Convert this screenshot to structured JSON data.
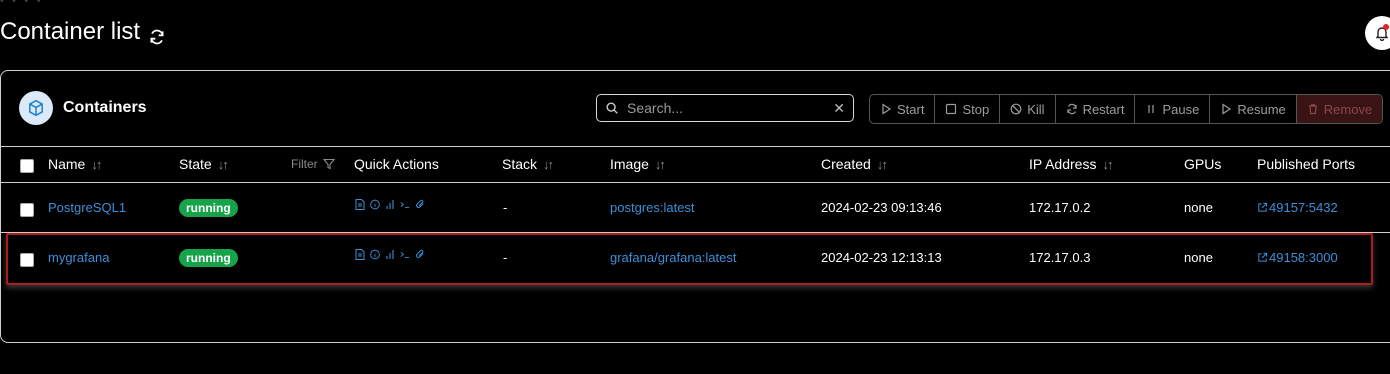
{
  "page": {
    "title": "Container list"
  },
  "panel": {
    "title": "Containers"
  },
  "search": {
    "placeholder": "Search..."
  },
  "actions": [
    "Start",
    "Stop",
    "Kill",
    "Restart",
    "Pause",
    "Resume",
    "Remove"
  ],
  "table": {
    "columns": [
      "Name",
      "State",
      "Quick Actions",
      "Stack",
      "Image",
      "Created",
      "IP Address",
      "GPUs",
      "Published Ports"
    ],
    "filter_label": "Filter",
    "rows": [
      {
        "name": "PostgreSQL1",
        "state": "running",
        "stack": "-",
        "image": "postgres:latest",
        "created": "2024-02-23 09:13:46",
        "ip": "172.17.0.2",
        "gpus": "none",
        "ports": "49157:5432"
      },
      {
        "name": "mygrafana",
        "state": "running",
        "stack": "-",
        "image": "grafana/grafana:latest",
        "created": "2024-02-23 12:13:13",
        "ip": "172.17.0.3",
        "gpus": "none",
        "ports": "49158:3000"
      }
    ]
  },
  "colors": {
    "link": "#3d8fd8",
    "running_badge": "#16a34a",
    "highlight_border": "#b11a1a"
  }
}
